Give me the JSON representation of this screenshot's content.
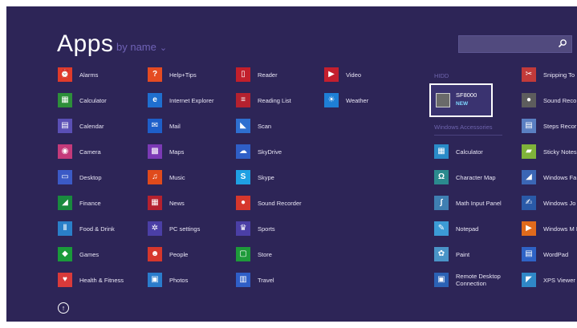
{
  "header": {
    "title": "Apps",
    "sort_label": "by name",
    "sort_chevron": "⌄"
  },
  "search": {
    "icon": "search-icon"
  },
  "columns": [
    [
      {
        "label": "Alarms",
        "icon": "alarm-icon",
        "color": "#e03b2b",
        "glyph": "⏰"
      },
      {
        "label": "Calculator",
        "icon": "calculator-icon",
        "color": "#2d8f3a",
        "glyph": "▦"
      },
      {
        "label": "Calendar",
        "icon": "calendar-icon",
        "color": "#5a4fb5",
        "glyph": "▤"
      },
      {
        "label": "Camera",
        "icon": "camera-icon",
        "color": "#c43a7a",
        "glyph": "◉"
      },
      {
        "label": "Desktop",
        "icon": "desktop-icon",
        "color": "#3b5ac6",
        "glyph": "▭"
      },
      {
        "label": "Finance",
        "icon": "finance-icon",
        "color": "#198a3e",
        "glyph": "◢"
      },
      {
        "label": "Food & Drink",
        "icon": "food-drink-icon",
        "color": "#2a7fc9",
        "glyph": "ǁ"
      },
      {
        "label": "Games",
        "icon": "games-icon",
        "color": "#1a9a3a",
        "glyph": "◆"
      },
      {
        "label": "Health & Fitness",
        "icon": "health-fitness-icon",
        "color": "#d93a3a",
        "glyph": "♥"
      }
    ],
    [
      {
        "label": "Help+Tips",
        "icon": "help-tips-icon",
        "color": "#e54b22",
        "glyph": "?"
      },
      {
        "label": "Internet Explorer",
        "icon": "internet-explorer-icon",
        "color": "#1f6fcf",
        "glyph": "e"
      },
      {
        "label": "Mail",
        "icon": "mail-icon",
        "color": "#1e5fc9",
        "glyph": "✉"
      },
      {
        "label": "Maps",
        "icon": "maps-icon",
        "color": "#7b3ab5",
        "glyph": "▩"
      },
      {
        "label": "Music",
        "icon": "music-icon",
        "color": "#e04a1c",
        "glyph": "♫"
      },
      {
        "label": "News",
        "icon": "news-icon",
        "color": "#b5212f",
        "glyph": "▦"
      },
      {
        "label": "PC settings",
        "icon": "pc-settings-icon",
        "color": "#4b3fa6",
        "glyph": "✲"
      },
      {
        "label": "People",
        "icon": "people-icon",
        "color": "#d6372c",
        "glyph": "☻"
      },
      {
        "label": "Photos",
        "icon": "photos-icon",
        "color": "#2a7ccc",
        "glyph": "▣"
      }
    ],
    [
      {
        "label": "Reader",
        "icon": "reader-icon",
        "color": "#c21f2b",
        "glyph": "▯"
      },
      {
        "label": "Reading List",
        "icon": "reading-list-icon",
        "color": "#b5212f",
        "glyph": "≡"
      },
      {
        "label": "Scan",
        "icon": "scan-icon",
        "color": "#2e6fd0",
        "glyph": "◣"
      },
      {
        "label": "SkyDrive",
        "icon": "skydrive-icon",
        "color": "#2f5fc7",
        "glyph": "☁"
      },
      {
        "label": "Skype",
        "icon": "skype-icon",
        "color": "#1fa0e3",
        "glyph": "S"
      },
      {
        "label": "Sound Recorder",
        "icon": "sound-recorder-icon",
        "color": "#d6372c",
        "glyph": "●"
      },
      {
        "label": "Sports",
        "icon": "sports-icon",
        "color": "#4b3fa6",
        "glyph": "♛"
      },
      {
        "label": "Store",
        "icon": "store-icon",
        "color": "#1e9a3a",
        "glyph": "▢"
      },
      {
        "label": "Travel",
        "icon": "travel-icon",
        "color": "#2f5fc7",
        "glyph": "▥"
      }
    ],
    [
      {
        "label": "Video",
        "icon": "video-icon",
        "color": "#c41f2e",
        "glyph": "▶"
      },
      {
        "label": "Weather",
        "icon": "weather-icon",
        "color": "#1e7fd6",
        "glyph": "☀"
      }
    ]
  ],
  "groups": {
    "hidden_header": "HIDD",
    "selected_app": {
      "label": "SF8000",
      "badge": "NEW",
      "icon": "sf8000-icon"
    },
    "accessories_header": "Windows Accessories",
    "accessories": [
      {
        "label": "Calculator",
        "icon": "calculator-icon",
        "color": "#2a8bc8",
        "glyph": "▦"
      },
      {
        "label": "Character Map",
        "icon": "character-map-icon",
        "color": "#2b8a8e",
        "glyph": "Ω"
      },
      {
        "label": "Math Input Panel",
        "icon": "math-input-panel-icon",
        "color": "#3f7fb2",
        "glyph": "∫"
      },
      {
        "label": "Notepad",
        "icon": "notepad-icon",
        "color": "#3c9bd6",
        "glyph": "✎"
      },
      {
        "label": "Paint",
        "icon": "paint-icon",
        "color": "#4a94c8",
        "glyph": "✿"
      },
      {
        "label": "Remote Desktop Connection",
        "icon": "remote-desktop-icon",
        "color": "#2b62b5",
        "glyph": "▣"
      }
    ],
    "right": [
      {
        "label": "Snipping To",
        "icon": "snipping-tool-icon",
        "color": "#c23a3a",
        "glyph": "✂"
      },
      {
        "label": "Sound Reco",
        "icon": "sound-recorder-icon",
        "color": "#5d5d5d",
        "glyph": "●"
      },
      {
        "label": "Steps Recor",
        "icon": "steps-recorder-icon",
        "color": "#5a7fc2",
        "glyph": "▤"
      },
      {
        "label": "Sticky Notes",
        "icon": "sticky-notes-icon",
        "color": "#7fb33a",
        "glyph": "▰"
      },
      {
        "label": "Windows Fa Scan",
        "icon": "windows-fax-scan-icon",
        "color": "#3b66b5",
        "glyph": "◢"
      },
      {
        "label": "Windows Jo",
        "icon": "windows-journal-icon",
        "color": "#2a5aa8",
        "glyph": "✍"
      },
      {
        "label": "Windows M Player",
        "icon": "windows-media-player-icon",
        "color": "#e06a1c",
        "glyph": "▶"
      },
      {
        "label": "WordPad",
        "icon": "wordpad-icon",
        "color": "#2f63c6",
        "glyph": "▤"
      },
      {
        "label": "XPS Viewer",
        "icon": "xps-viewer-icon",
        "color": "#2f88c7",
        "glyph": "◤"
      }
    ]
  },
  "scrollbar": {
    "position_fraction": 0.7
  },
  "up_button": {
    "glyph": "↑"
  }
}
